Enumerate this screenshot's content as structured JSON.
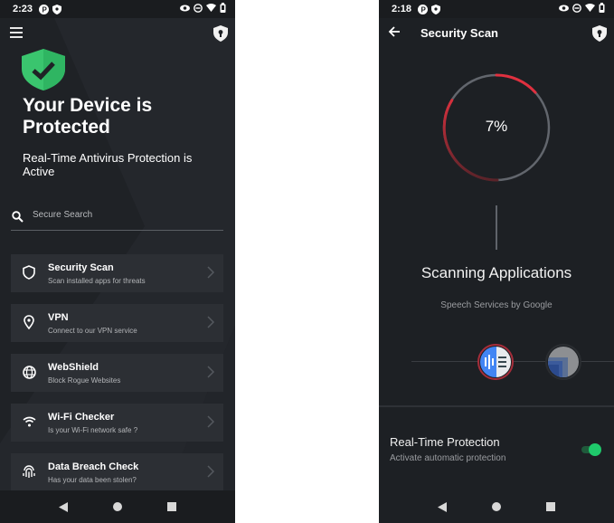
{
  "left_screen": {
    "status_bar": {
      "time": "2:23"
    },
    "hero": {
      "title": "Your Device is Protected",
      "subtitle": "Real-Time Antivirus Protection is Active",
      "status_color": "#2ecc71"
    },
    "search": {
      "placeholder": "Secure Search",
      "value": ""
    },
    "features": [
      {
        "title": "Security Scan",
        "subtitle": "Scan installed apps for threats",
        "icon": "shield-outline-icon"
      },
      {
        "title": "VPN",
        "subtitle": "Connect to our VPN service",
        "icon": "location-pin-icon"
      },
      {
        "title": "WebShield",
        "subtitle": "Block Rogue Websites",
        "icon": "globe-icon"
      },
      {
        "title": "Wi-Fi Checker",
        "subtitle": "Is your Wi-Fi network safe ?",
        "icon": "wifi-icon"
      },
      {
        "title": "Data Breach Check",
        "subtitle": "Has your data been stolen?",
        "icon": "fingerprint-icon"
      }
    ]
  },
  "right_screen": {
    "status_bar": {
      "time": "2:18"
    },
    "header": {
      "title": "Security Scan"
    },
    "scan": {
      "progress_percent": 7,
      "progress_label": "7%",
      "status_title": "Scanning Applications",
      "current_app": "Speech Services by Google",
      "accent_color": "#e0303f"
    },
    "realtime": {
      "title": "Real-Time Protection",
      "subtitle": "Activate automatic protection",
      "enabled": true,
      "toggle_color": "#1fc96b"
    }
  }
}
